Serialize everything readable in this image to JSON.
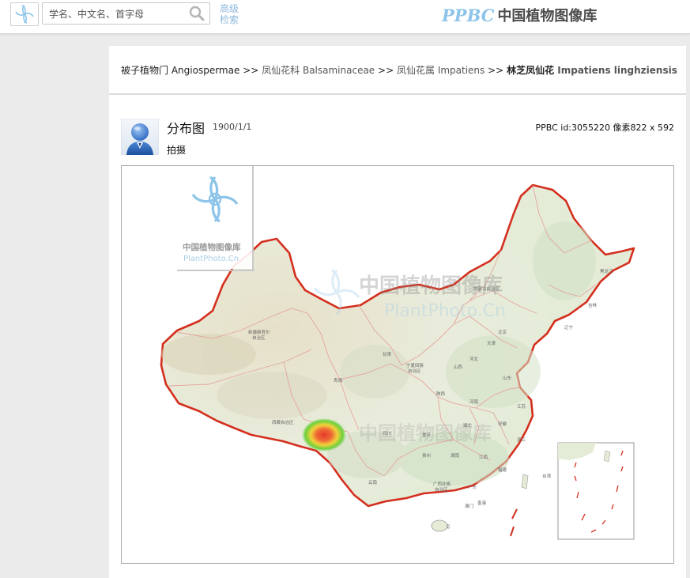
{
  "header": {
    "search_placeholder": "学名、中文名、首字母",
    "advanced_line1": "高级",
    "advanced_line2": "检索",
    "brand_latin": "PPBC",
    "brand_chinese": "中国植物图像库",
    "accent_color": "#8cc4ea"
  },
  "breadcrumb": {
    "items": [
      {
        "cn": "被子植物门",
        "latin": "Angiospermae"
      },
      {
        "cn": "凤仙花科",
        "latin": "Balsaminaceae"
      },
      {
        "cn": "凤仙花属",
        "latin": "Impatiens"
      }
    ],
    "separator": ">>",
    "current": {
      "cn": "林芝凤仙花",
      "latin": "Impatiens linghziensis"
    }
  },
  "photo": {
    "title": "分布图",
    "date": "1900/1/1",
    "info": "PPBC id:3055220 像素822 x 592",
    "shot_label": "拍摄"
  },
  "map": {
    "watermark_cn": "中国植物图像库",
    "watermark_en": "PlantPhoto.Cn",
    "center_watermark_cn": "中国植物图像库",
    "center_watermark_en": "PlantPhoto.Cn",
    "region_labels": [
      "新疆维吾尔自治区",
      "西藏自治区",
      "青海",
      "甘肃",
      "内蒙古自治区",
      "黑龙江",
      "吉林",
      "辽宁",
      "北京",
      "天津",
      "河北",
      "山西",
      "陕西",
      "宁夏回族自治区",
      "山东",
      "河南",
      "江苏",
      "安徽",
      "湖北",
      "四川",
      "重庆",
      "贵州",
      "湖南",
      "江西",
      "浙江",
      "福建",
      "云南",
      "广西壮族自治区",
      "广东",
      "海南",
      "台湾",
      "香港",
      "澳门"
    ],
    "heat_color_core": "#e53a2a",
    "heat_color_mid": "#f2d23c",
    "heat_color_outer": "#6cd03c",
    "border_color": "#d42f1e"
  }
}
